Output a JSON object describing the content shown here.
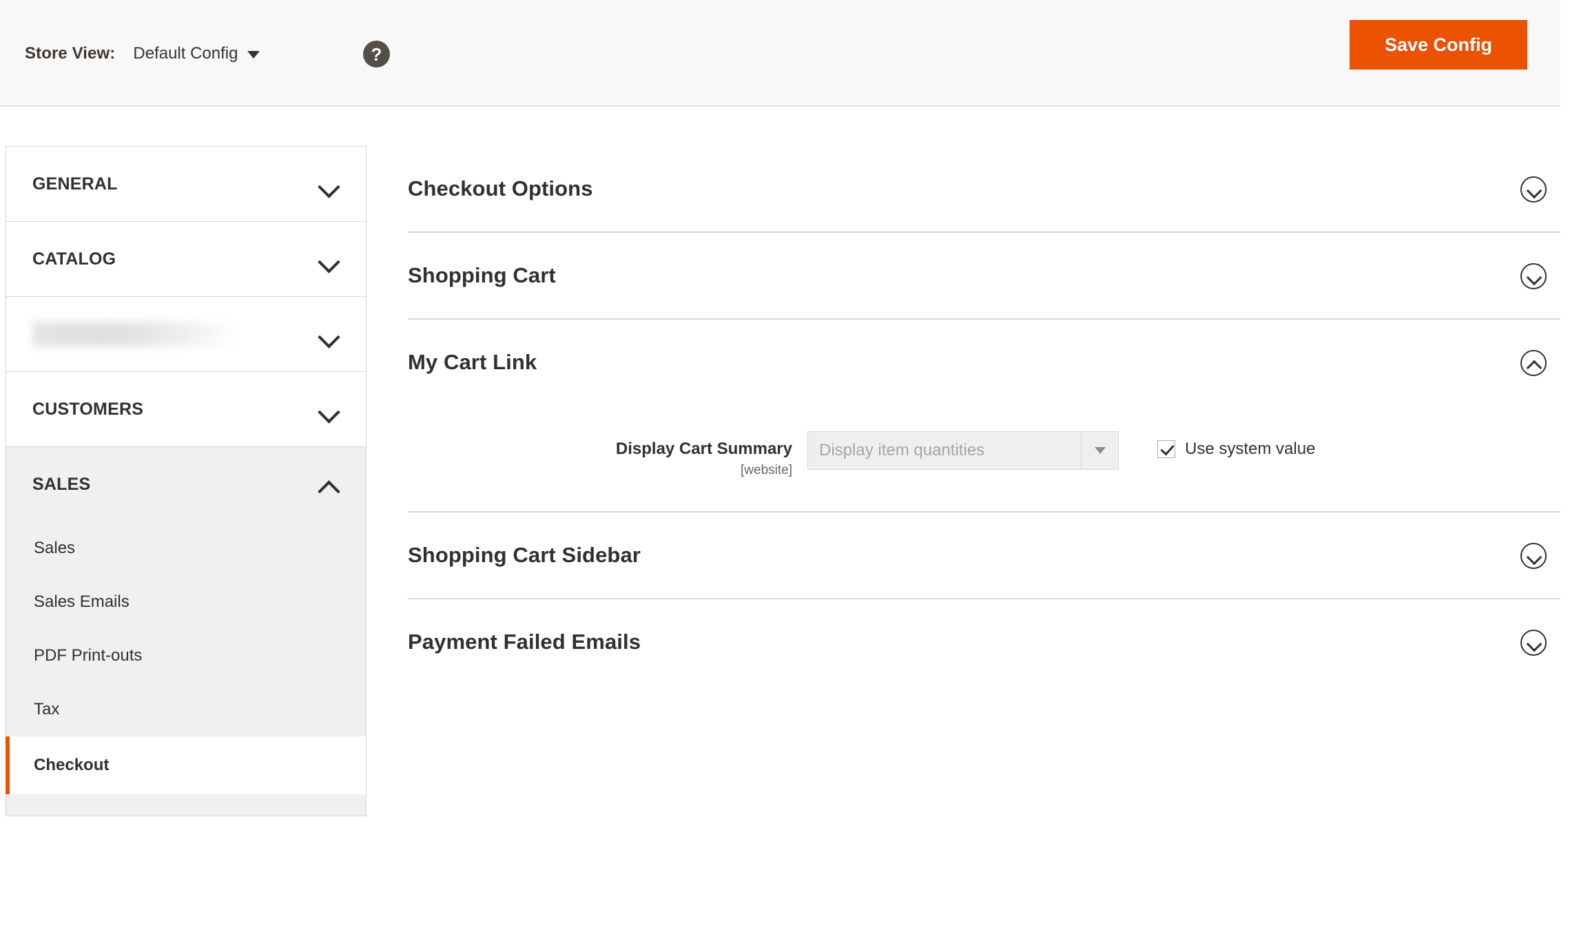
{
  "header": {
    "store_view_label": "Store View:",
    "store_view_value": "Default Config",
    "help_icon": "question-mark-icon",
    "save_button": "Save Config",
    "accent_color": "#eb5202"
  },
  "sidebar": {
    "sections": [
      {
        "label": "GENERAL",
        "expanded": false
      },
      {
        "label": "CATALOG",
        "expanded": false
      },
      {
        "label": "",
        "expanded": false,
        "redacted": true
      },
      {
        "label": "CUSTOMERS",
        "expanded": false
      },
      {
        "label": "SALES",
        "expanded": true
      }
    ],
    "sub_items": [
      {
        "label": "Sales",
        "current": false
      },
      {
        "label": "Sales Emails",
        "current": false
      },
      {
        "label": "PDF Print-outs",
        "current": false
      },
      {
        "label": "Tax",
        "current": false
      },
      {
        "label": "Checkout",
        "current": true
      }
    ]
  },
  "content": {
    "sections": [
      {
        "title": "Checkout Options",
        "expanded": false
      },
      {
        "title": "Shopping Cart",
        "expanded": false
      },
      {
        "title": "My Cart Link",
        "expanded": true
      },
      {
        "title": "Shopping Cart Sidebar",
        "expanded": false
      },
      {
        "title": "Payment Failed Emails",
        "expanded": false
      }
    ],
    "my_cart_link": {
      "field_label": "Display Cart Summary",
      "field_scope": "[website]",
      "select_value": "Display item quantities",
      "use_system_value_label": "Use system value",
      "use_system_value_checked": true
    }
  }
}
